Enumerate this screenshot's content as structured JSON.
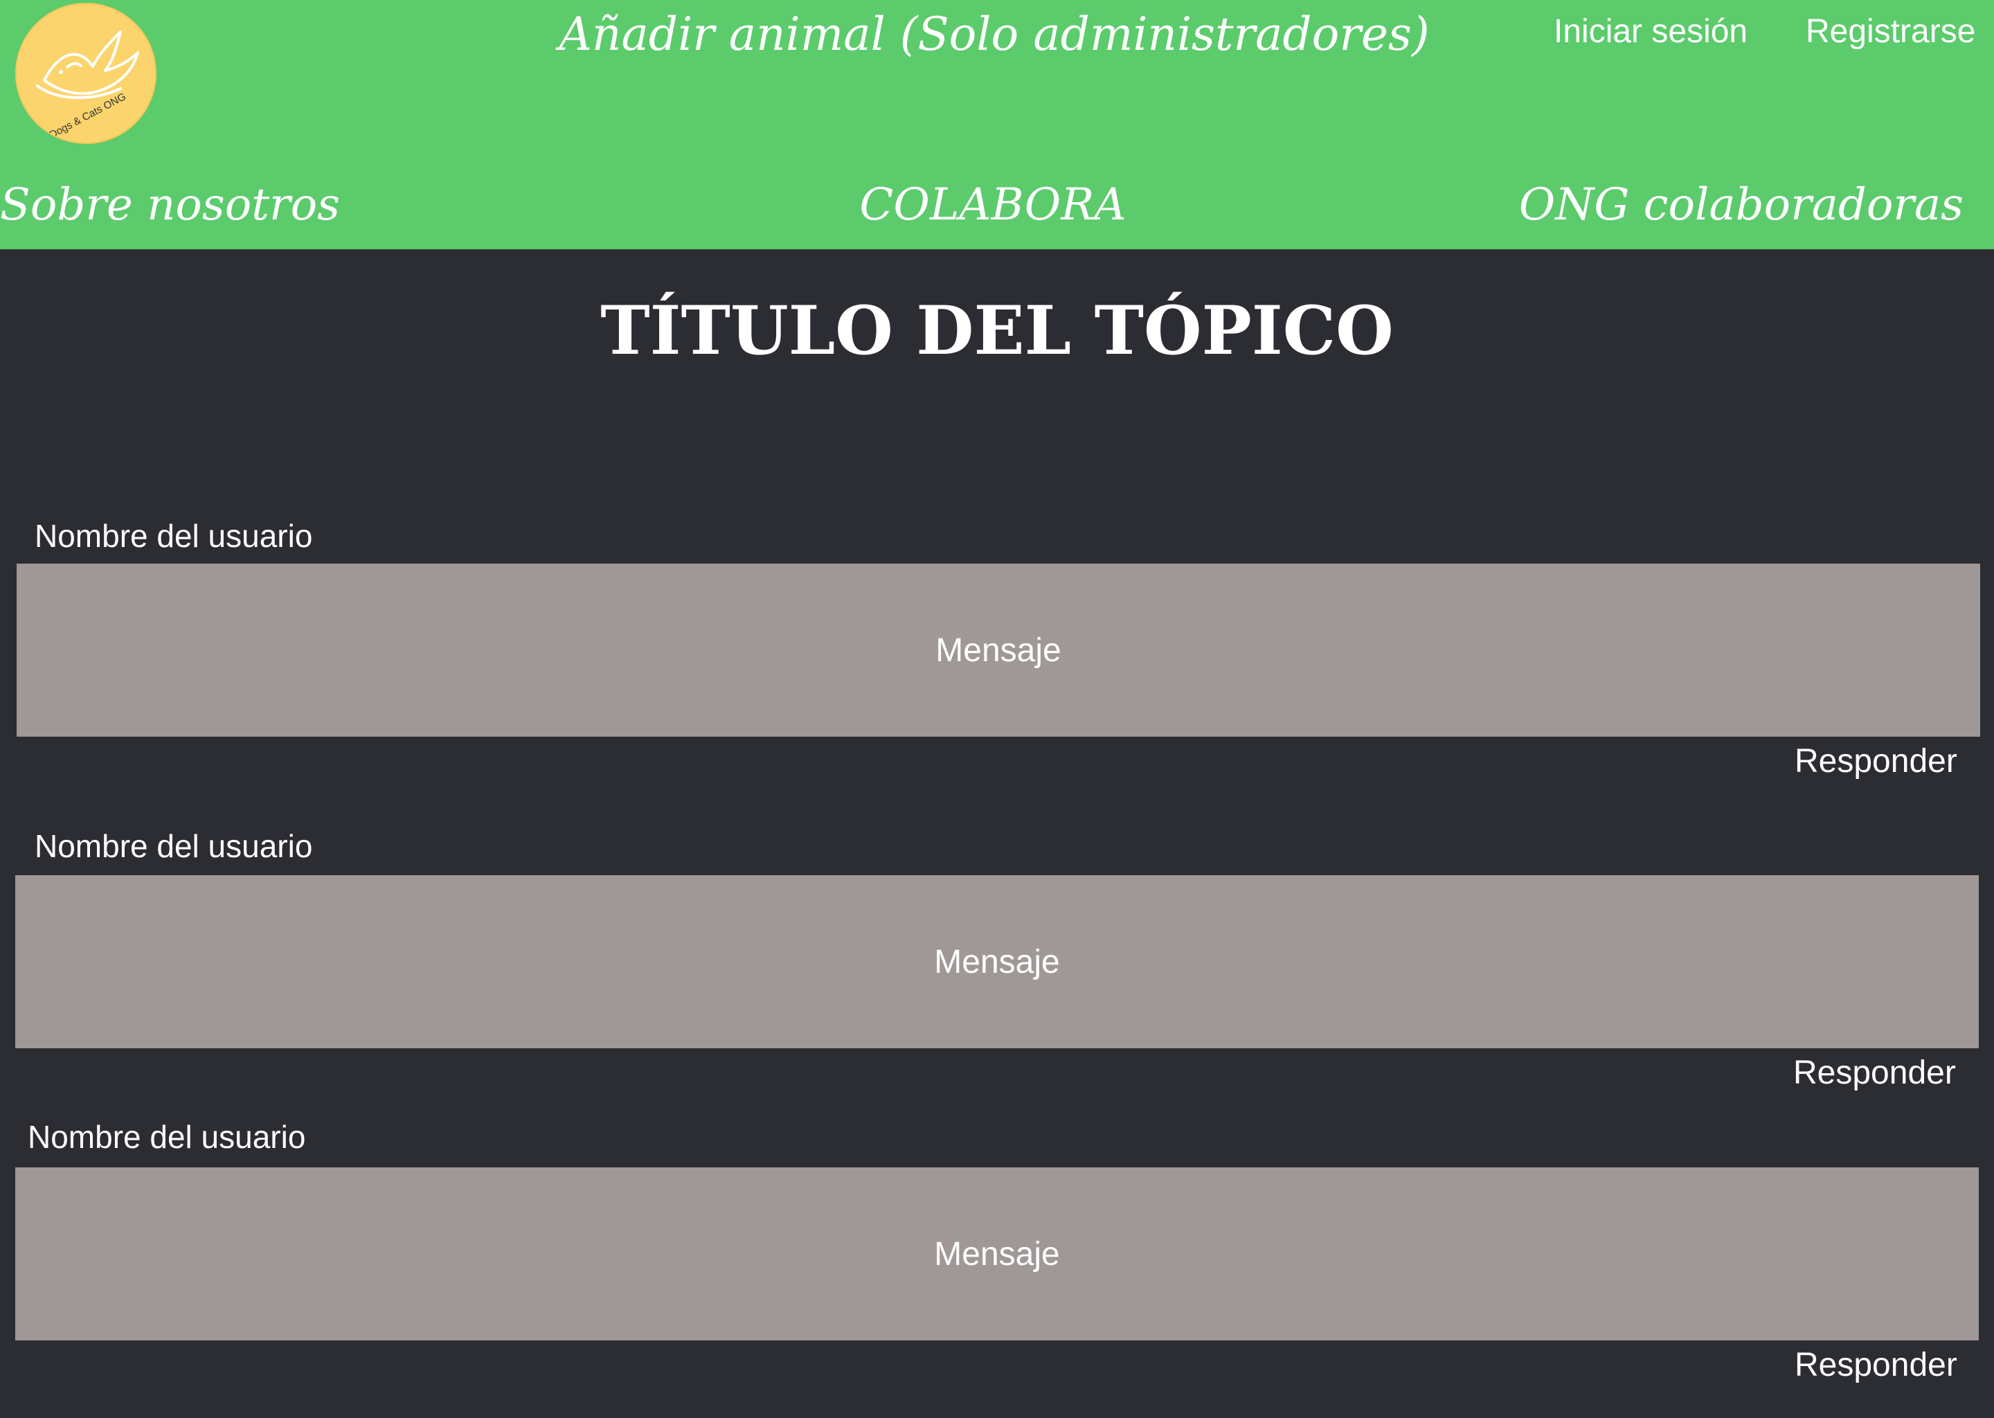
{
  "header": {
    "logo_text": "Dogs & Cats ONG",
    "admin_link": "Añadir animal (Solo administradores)",
    "login_link": "Iniciar sesión",
    "register_link": "Registrarse",
    "nav": [
      {
        "label": "Sobre nosotros"
      },
      {
        "label": "COLABORA"
      },
      {
        "label": "ONG colaboradoras"
      }
    ]
  },
  "topic": {
    "title": "TÍTULO DEL TÓPICO"
  },
  "posts": [
    {
      "user": "Nombre del usuario",
      "message": "Mensaje",
      "reply_label": "Responder"
    },
    {
      "user": "Nombre del usuario",
      "message": "Mensaje",
      "reply_label": "Responder"
    },
    {
      "user": "Nombre del usuario",
      "message": "Mensaje",
      "reply_label": "Responder"
    }
  ],
  "colors": {
    "header_bg": "#5ccb6c",
    "page_bg": "#2c2d33",
    "message_bg": "#a09797",
    "logo_bg": "#fbd46d"
  }
}
